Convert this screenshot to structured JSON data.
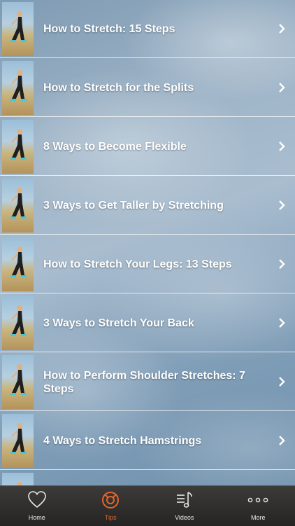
{
  "list": {
    "items": [
      {
        "title": "How to Stretch: 15 Steps"
      },
      {
        "title": "How to Stretch for the Splits"
      },
      {
        "title": "8 Ways to Become Flexible"
      },
      {
        "title": "3 Ways to Get Taller by Stretching"
      },
      {
        "title": "How to Stretch Your Legs: 13 Steps"
      },
      {
        "title": "3 Ways to Stretch Your Back"
      },
      {
        "title": "How to Perform Shoulder Stretches: 7 Steps"
      },
      {
        "title": "4 Ways to Stretch Hamstrings"
      },
      {
        "title": ""
      }
    ]
  },
  "tabbar": {
    "tabs": [
      {
        "label": "Home",
        "icon": "heart-icon"
      },
      {
        "label": "Tips",
        "icon": "lifebuoy-icon",
        "active": true
      },
      {
        "label": "Videos",
        "icon": "video-list-icon"
      },
      {
        "label": "More",
        "icon": "more-dots-icon"
      }
    ]
  },
  "colors": {
    "accent": "#e8642a",
    "tabbar": "#2e2d2b",
    "text": "#ffffff"
  }
}
